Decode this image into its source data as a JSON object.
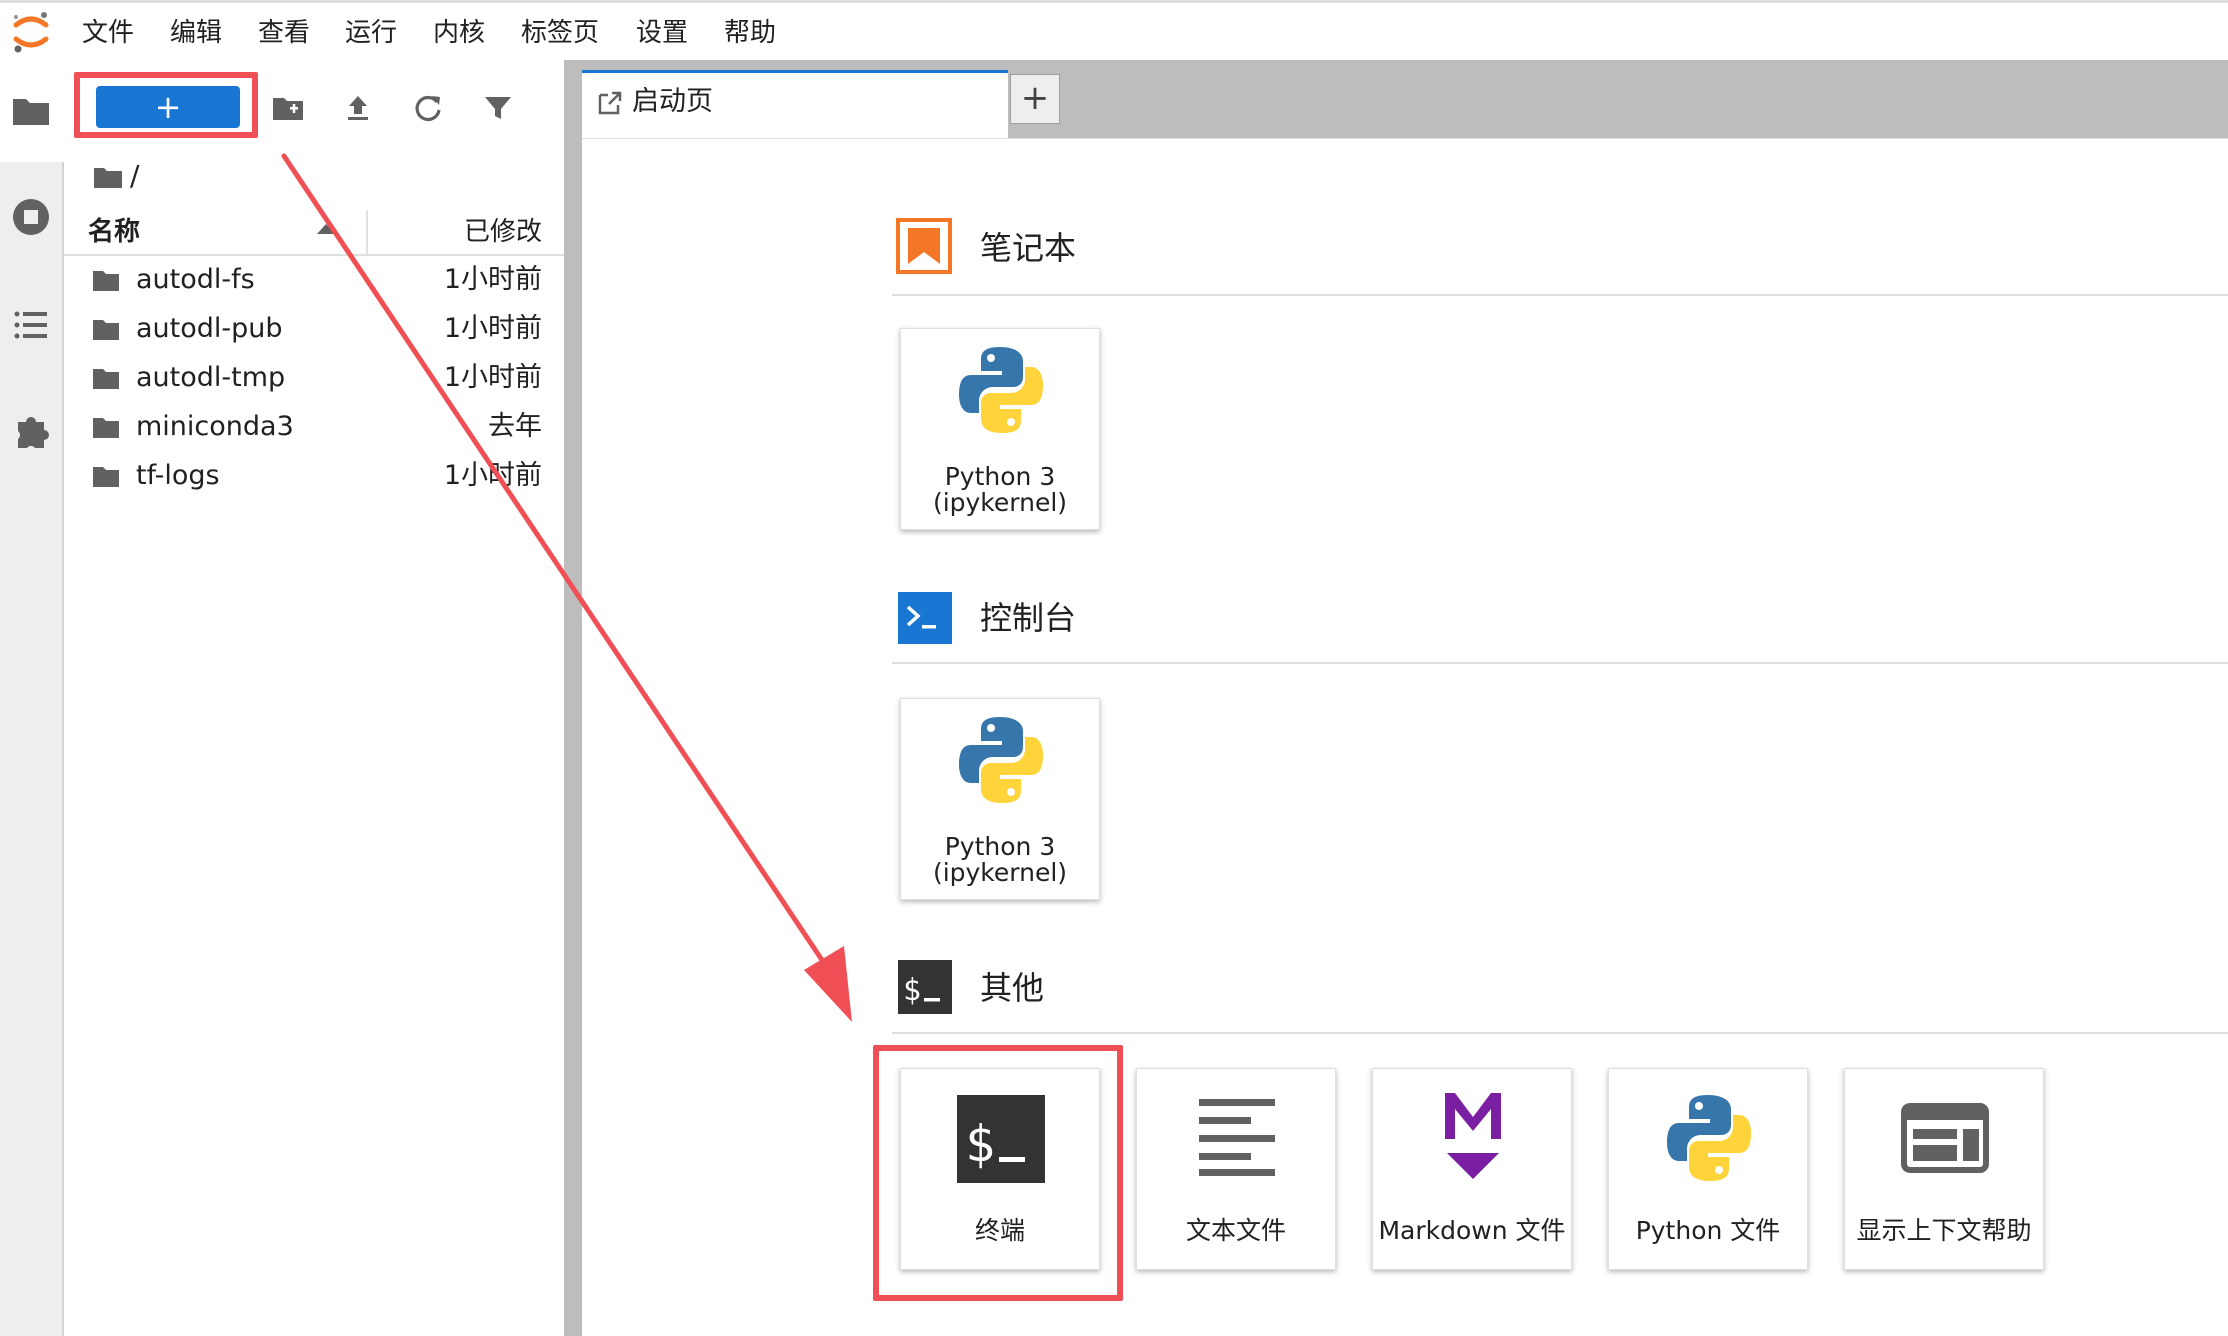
{
  "menubar": {
    "items": [
      "文件",
      "编辑",
      "查看",
      "运行",
      "内核",
      "标签页",
      "设置",
      "帮助"
    ]
  },
  "activitybar": {
    "icons": [
      "folder-icon",
      "running-icon",
      "toc-icon",
      "extension-icon"
    ]
  },
  "filebrowser": {
    "new_button_label": "+",
    "breadcrumb": "/",
    "columns": {
      "name": "名称",
      "modified": "已修改"
    },
    "files": [
      {
        "name": "autodl-fs",
        "modified": "1小时前"
      },
      {
        "name": "autodl-pub",
        "modified": "1小时前"
      },
      {
        "name": "autodl-tmp",
        "modified": "1小时前"
      },
      {
        "name": "miniconda3",
        "modified": "去年"
      },
      {
        "name": "tf-logs",
        "modified": "1小时前"
      }
    ]
  },
  "tabs": {
    "launcher_label": "启动页",
    "add_label": "+"
  },
  "launcher": {
    "notebook": {
      "title": "笔记本",
      "card_line1": "Python 3",
      "card_line2": "(ipykernel)"
    },
    "console": {
      "title": "控制台",
      "card_line1": "Python 3",
      "card_line2": "(ipykernel)"
    },
    "other": {
      "title": "其他",
      "cards": [
        "终端",
        "文本文件",
        "Markdown 文件",
        "Python 文件",
        "显示上下文帮助"
      ]
    }
  },
  "colors": {
    "accent": "#1976d2",
    "highlight": "#ef4f55",
    "notebook_orange": "#f37726",
    "markdown_purple": "#7b1fa2"
  }
}
